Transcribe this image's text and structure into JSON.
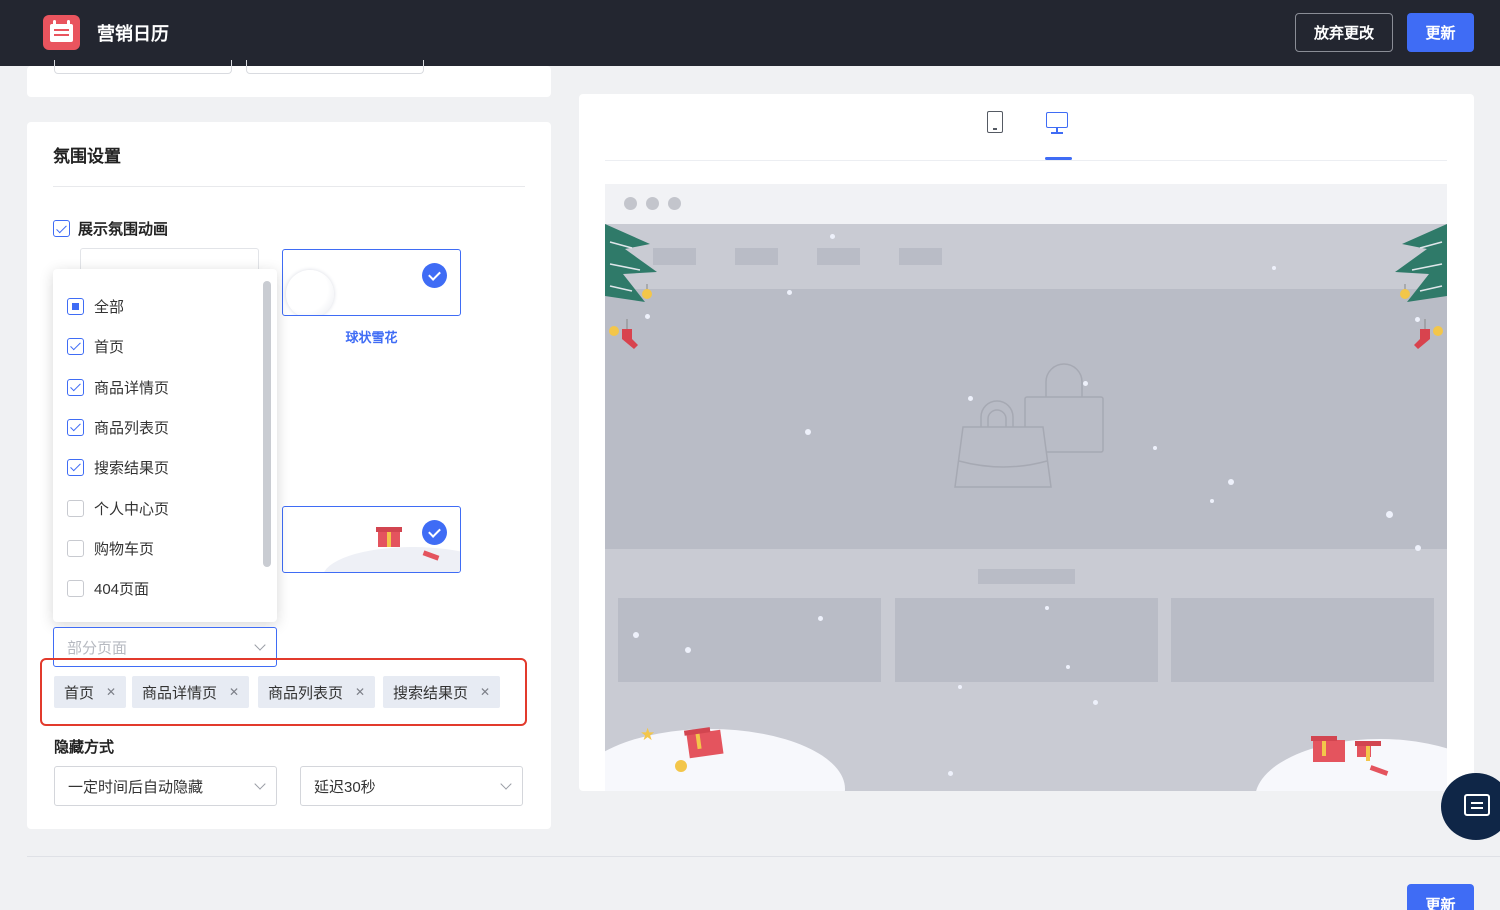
{
  "app": {
    "title": "营销日历"
  },
  "header": {
    "discard_label": "放弃更改",
    "update_label": "更新"
  },
  "atmosphere": {
    "section_title": "氛围设置",
    "show_animation": {
      "label": "展示氛围动画",
      "checked": true
    },
    "effects": [
      {
        "label": "球状雪花",
        "selected": true,
        "icon": "snowball-icon"
      },
      {
        "label": "",
        "selected": true,
        "icon": "gift-icon"
      }
    ],
    "page_dropdown": {
      "items": [
        {
          "label": "全部",
          "state": "indeterminate"
        },
        {
          "label": "首页",
          "state": "checked"
        },
        {
          "label": "商品详情页",
          "state": "checked"
        },
        {
          "label": "商品列表页",
          "state": "checked"
        },
        {
          "label": "搜索结果页",
          "state": "checked"
        },
        {
          "label": "个人中心页",
          "state": "unchecked"
        },
        {
          "label": "购物车页",
          "state": "unchecked"
        },
        {
          "label": "404页面",
          "state": "unchecked"
        }
      ]
    },
    "page_select": {
      "placeholder": "部分页面"
    },
    "selected_tags": [
      "首页",
      "商品详情页",
      "商品列表页",
      "搜索结果页"
    ],
    "hide_mode": {
      "label": "隐藏方式",
      "mode_value": "一定时间后自动隐藏",
      "delay_value": "延迟30秒"
    }
  },
  "preview": {
    "active_device": "desktop",
    "devices": [
      "tablet-icon",
      "desktop-icon"
    ]
  },
  "footer": {
    "update_label": "更新"
  },
  "colors": {
    "accent": "#3f6cf5",
    "topbar": "#232630",
    "highlight_frame": "#e23a2c"
  }
}
